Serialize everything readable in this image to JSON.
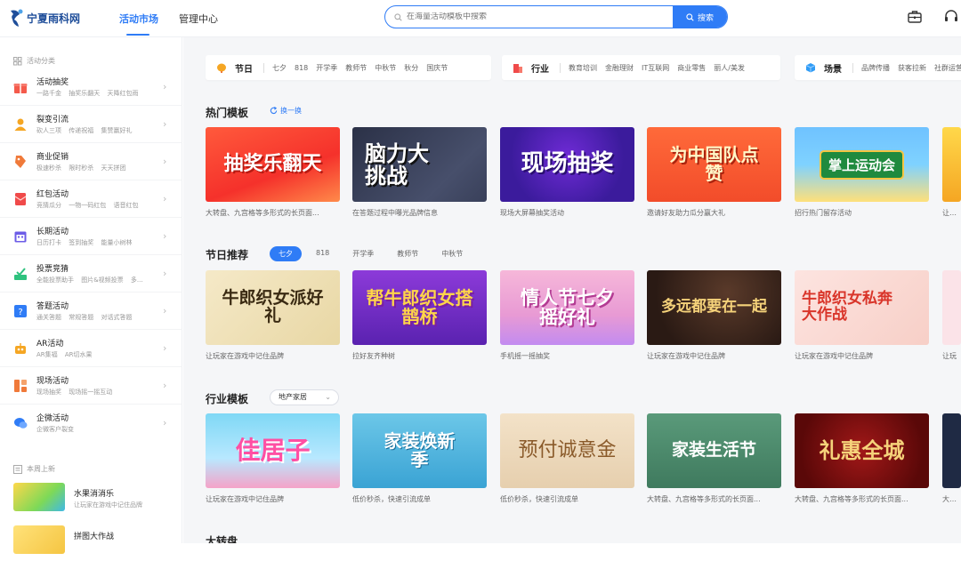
{
  "header": {
    "logo_text": "宁夏雨科网",
    "nav": [
      {
        "label": "活动市场",
        "active": true
      },
      {
        "label": "管理中心",
        "active": false
      }
    ],
    "search_placeholder": "在海量活动模板中搜索",
    "search_button": "搜索",
    "icons": [
      "toolbox-icon",
      "headset-icon"
    ]
  },
  "sidebar": {
    "section_label": "活动分类",
    "categories": [
      {
        "title": "活动抽奖",
        "sub": "一路千金 抽奖乐翻天 天降红包雨",
        "icon": "gift-icon",
        "color": "#f45a4b"
      },
      {
        "title": "裂变引流",
        "sub": "砍人三项 传递祝福 集赞赢好礼",
        "icon": "user-icon",
        "color": "#f5a623"
      },
      {
        "title": "商业促销",
        "sub": "极速秒杀 限时秒杀 天天拼团",
        "icon": "tag-icon",
        "color": "#f07a3a"
      },
      {
        "title": "红包活动",
        "sub": "竞猜瓜分 一物一码红包 语音红包",
        "icon": "red-envelope-icon",
        "color": "#f04a4a"
      },
      {
        "title": "长期活动",
        "sub": "日历打卡 签到抽奖 能量小树林",
        "icon": "calendar-icon",
        "color": "#6c5ce7"
      },
      {
        "title": "投票竞猜",
        "sub": "全能投票助手 图片&视频投票 多...",
        "icon": "vote-icon",
        "color": "#2ec27e"
      },
      {
        "title": "答题活动",
        "sub": "通关答题 常规答题 对话式答题",
        "icon": "question-icon",
        "color": "#2f7cf6"
      },
      {
        "title": "AR活动",
        "sub": "AR集福 AR切水果",
        "icon": "robot-icon",
        "color": "#f5a623"
      },
      {
        "title": "现场活动",
        "sub": "现场抽奖 现场摇一摇互动",
        "icon": "grid-icon",
        "color": "#f07a3a"
      },
      {
        "title": "企微活动",
        "sub": "企微客户裂变",
        "icon": "chat-icon",
        "color": "#2f7cf6"
      }
    ],
    "new_section_label": "本周上新",
    "new_items": [
      {
        "title": "水果消消乐",
        "sub": "让玩家在游戏中记住品牌"
      },
      {
        "title": "拼图大作战",
        "sub": ""
      }
    ]
  },
  "filters": [
    {
      "title": "节日",
      "icon": "lantern-icon",
      "tags": [
        "七夕",
        "818",
        "开学季",
        "教师节",
        "中秋节",
        "秋分",
        "国庆节"
      ]
    },
    {
      "title": "行业",
      "icon": "building-icon",
      "tags": [
        "教育培训",
        "金融理财",
        "IT互联网",
        "商业零售",
        "丽人/美发"
      ]
    },
    {
      "title": "场景",
      "icon": "cube-icon",
      "tags": [
        "品牌传播",
        "获客拉新",
        "社群运营"
      ]
    }
  ],
  "sections": {
    "hot": {
      "title": "热门模板",
      "refresh": "换一换",
      "cards": [
        {
          "banner": "抽奖乐翻天",
          "caption": "大转盘、九宫格等多形式的长页面..."
        },
        {
          "banner": "脑力大挑战",
          "caption": "在答题过程中曝光品牌信息"
        },
        {
          "banner": "现场抽奖",
          "caption": "现场大屏幕抽奖活动"
        },
        {
          "banner": "为中国队点赞",
          "caption": "邀请好友助力瓜分赢大礼"
        },
        {
          "banner": "掌上运动会",
          "caption": "招行热门留存活动"
        },
        {
          "banner": "",
          "caption": "让玩家"
        }
      ]
    },
    "festival": {
      "title": "节日推荐",
      "tabs": [
        {
          "label": "七夕",
          "active": true
        },
        {
          "label": "818",
          "active": false
        },
        {
          "label": "开学季",
          "active": false
        },
        {
          "label": "教师节",
          "active": false
        },
        {
          "label": "中秋节",
          "active": false
        }
      ],
      "cards": [
        {
          "banner": "牛郎织女派好礼",
          "caption": "让玩家在游戏中记住品牌"
        },
        {
          "banner": "帮牛郎织女搭鹊桥",
          "caption": "拉好友齐种树"
        },
        {
          "banner": "情人节七夕摇好礼",
          "caption": "手机摇一摇抽奖"
        },
        {
          "banner": "多远都要在一起",
          "caption": "让玩家在游戏中记住品牌"
        },
        {
          "banner": "牛郎织女私奔大作战",
          "caption": "让玩家在游戏中记住品牌"
        },
        {
          "banner": "",
          "caption": "让玩"
        }
      ]
    },
    "industry": {
      "title": "行业模板",
      "select": "地产家居",
      "cards": [
        {
          "banner": "佳居子",
          "caption": "让玩家在游戏中记住品牌"
        },
        {
          "banner": "家装焕新季",
          "caption": "低价秒杀，快速引流成单"
        },
        {
          "banner": "预付诚意金",
          "caption": "低价秒杀，快速引流成单"
        },
        {
          "banner": "家装生活节",
          "caption": "大转盘、九宫格等多形式的长页面..."
        },
        {
          "banner": "礼惠全城",
          "caption": "大转盘、九宫格等多形式的长页面..."
        },
        {
          "banner": "",
          "caption": "大转盘"
        }
      ]
    },
    "next": {
      "title": "大转盘"
    }
  },
  "colors": {
    "accent": "#2f7cf6",
    "page_bg": "#f5f6f8"
  }
}
